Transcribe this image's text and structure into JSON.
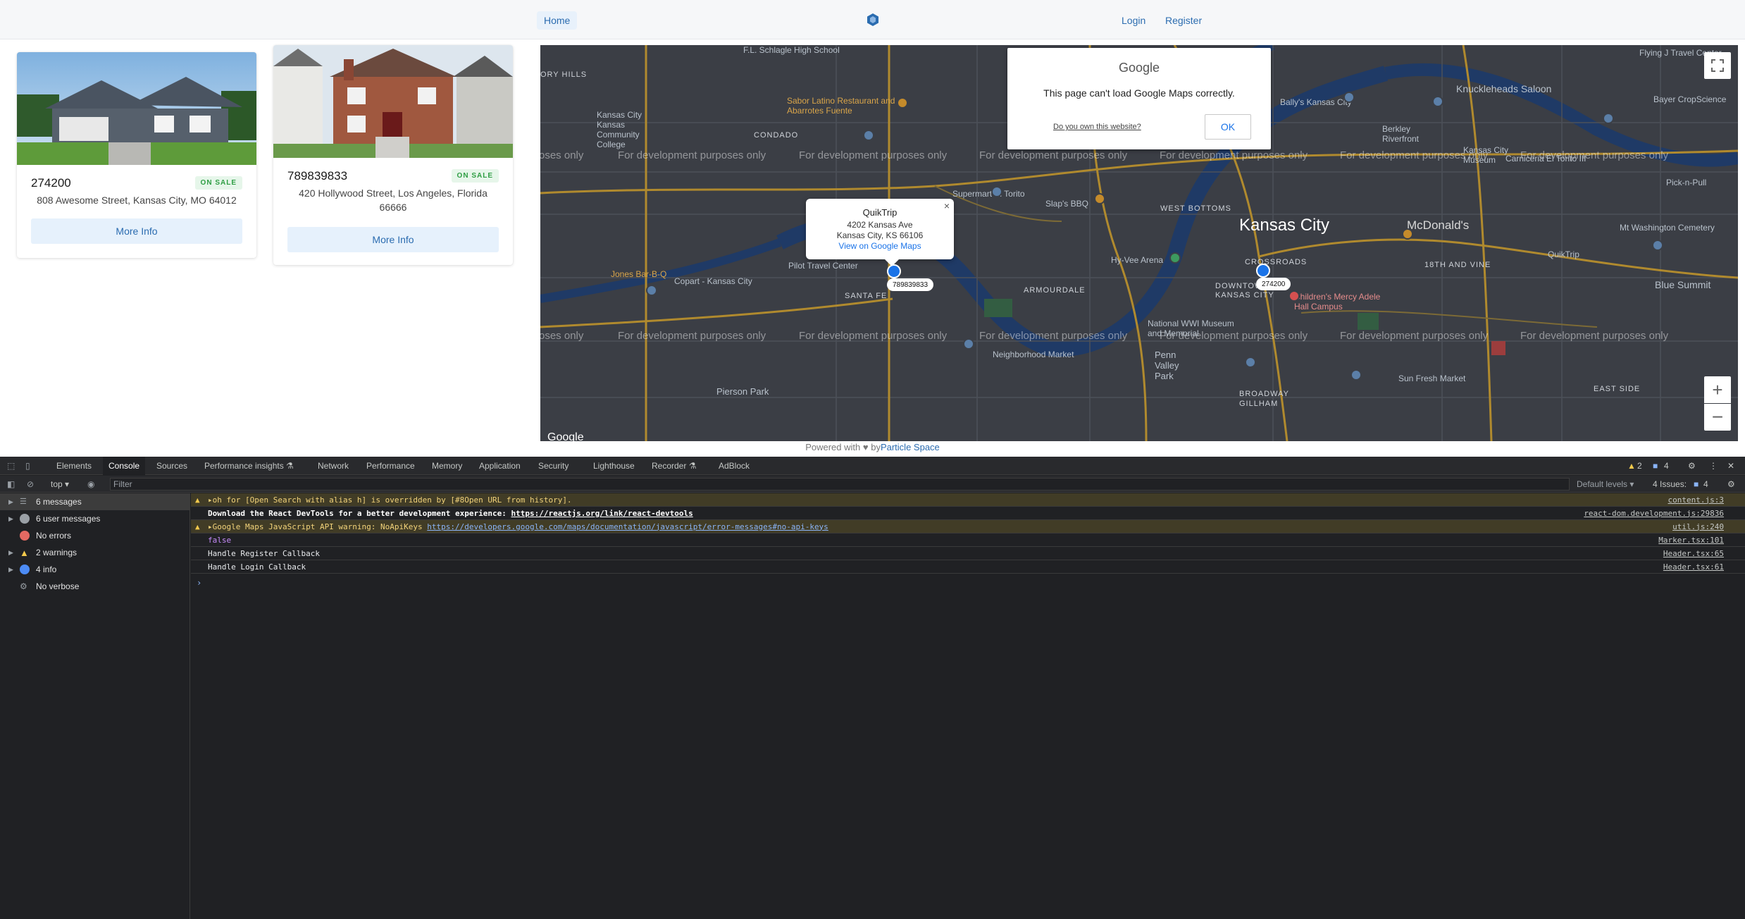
{
  "nav": {
    "home": "Home",
    "login": "Login",
    "register": "Register"
  },
  "cards": [
    {
      "price": "274200",
      "badge": "ON SALE",
      "address": "808 Awesome Street, Kansas City, MO 64012",
      "button": "More Info"
    },
    {
      "price": "789839833",
      "badge": "ON SALE",
      "address": "420 Hollywood Street, Los Angeles, Florida 66666",
      "button": "More Info"
    }
  ],
  "map": {
    "dev_watermark": "For development purposes only",
    "dialog": {
      "logo": "Google",
      "message": "This page can't load Google Maps correctly.",
      "own_link": "Do you own this website?",
      "ok": "OK"
    },
    "info_window": {
      "title": "QuikTrip",
      "line1": "4202 Kansas Ave",
      "line2": "Kansas City, KS 66106",
      "link": "View on Google Maps",
      "close": "×"
    },
    "markers": [
      "789839833",
      "274200"
    ],
    "labels": {
      "city": "Kansas City",
      "west_bottoms": "WEST BOTTOMS",
      "armourdale": "ARMOURDALE",
      "crossroads": "CROSSROADS",
      "downtown": "DOWNTOWN KANSAS CITY",
      "santa_fe": "SANTA FE",
      "condado": "CONDADO",
      "eighteenth_vine": "18TH AND VINE",
      "east_side": "EAST SIDE",
      "broadway": "BROADWAY GILLHAM",
      "mcdonalds": "McDonald's",
      "blue_summit": "Blue Summit",
      "pierson_park": "Pierson Park",
      "penn_valley": "Penn Valley Park",
      "hyvee": "Hy-Vee Arena",
      "slaps": "Slap's BBQ",
      "sun_fresh": "Sun Fresh Market",
      "neighborhood": "Neighborhood Market",
      "childrens": "Children's Mercy Adele Hall Campus",
      "pilot": "Pilot Travel Center",
      "copart": "Copart - Kansas City",
      "jones": "Jones Bar-B-Q",
      "sabor": "Sabor Latino Restaurant and Abarrotes Fuente",
      "kck_college": "Kansas City Kansas Community College",
      "fl_schlagle": "F.L. Schlagle High School",
      "flying_j": "Flying J Travel Center",
      "knuckleheads": "Knuckleheads Saloon",
      "berkley": "Berkley Riverfront",
      "kc_museum": "Kansas City Museum",
      "pick_n_pull": "Pick-n-Pull",
      "mt_washington": "Mt Washington Cemetery",
      "bayer": "Bayer CropScience",
      "ballys": "Bally's Kansas City",
      "carniceria": "Carniceria El Torito III",
      "supermart": "Supermart El Torito",
      "wwi_museum": "National WWI Museum and Memorial",
      "quiktrip": "QuikTrip",
      "tory_hills": "ORY HILLS",
      "poses": "oses only"
    },
    "google_mark": "Google"
  },
  "footer": {
    "prefix": "Powered with",
    "by": "by",
    "brand": "Particle Space"
  },
  "devtools": {
    "tabs": [
      "Elements",
      "Console",
      "Sources",
      "Performance insights ⚗",
      "Network",
      "Performance",
      "Memory",
      "Application",
      "Security",
      "Lighthouse",
      "Recorder ⚗",
      "AdBlock"
    ],
    "warnings_count": "2",
    "messages_count": "4",
    "context": "top ▾",
    "filter_placeholder": "Filter",
    "levels": "Default levels ▾",
    "issues": "4 Issues:",
    "issues_count": "4",
    "sidebar": [
      {
        "label": "6 messages"
      },
      {
        "label": "6 user messages"
      },
      {
        "label": "No errors"
      },
      {
        "label": "2 warnings"
      },
      {
        "label": "4 info"
      },
      {
        "label": "No verbose"
      }
    ],
    "logs": [
      {
        "msg": "▸oh for [Open Search with alias h] is overridden by [#8Open URL from history].",
        "src": "content.js:3"
      },
      {
        "msg_a": "Download the React DevTools for a better development experience: ",
        "link": "https://reactjs.org/link/react-devtools",
        "src": "react-dom.development.js:29836"
      },
      {
        "msg_a": "▸Google Maps JavaScript API warning: NoApiKeys ",
        "link": "https://developers.google.com/maps/documentation/javascript/error-messages#no-api-keys",
        "src": "util.js:240"
      },
      {
        "msg": "false",
        "src": "Marker.tsx:101"
      },
      {
        "msg": "Handle Register Callback",
        "src": "Header.tsx:65"
      },
      {
        "msg": "Handle Login Callback",
        "src": "Header.tsx:61"
      }
    ],
    "prompt": "›"
  }
}
